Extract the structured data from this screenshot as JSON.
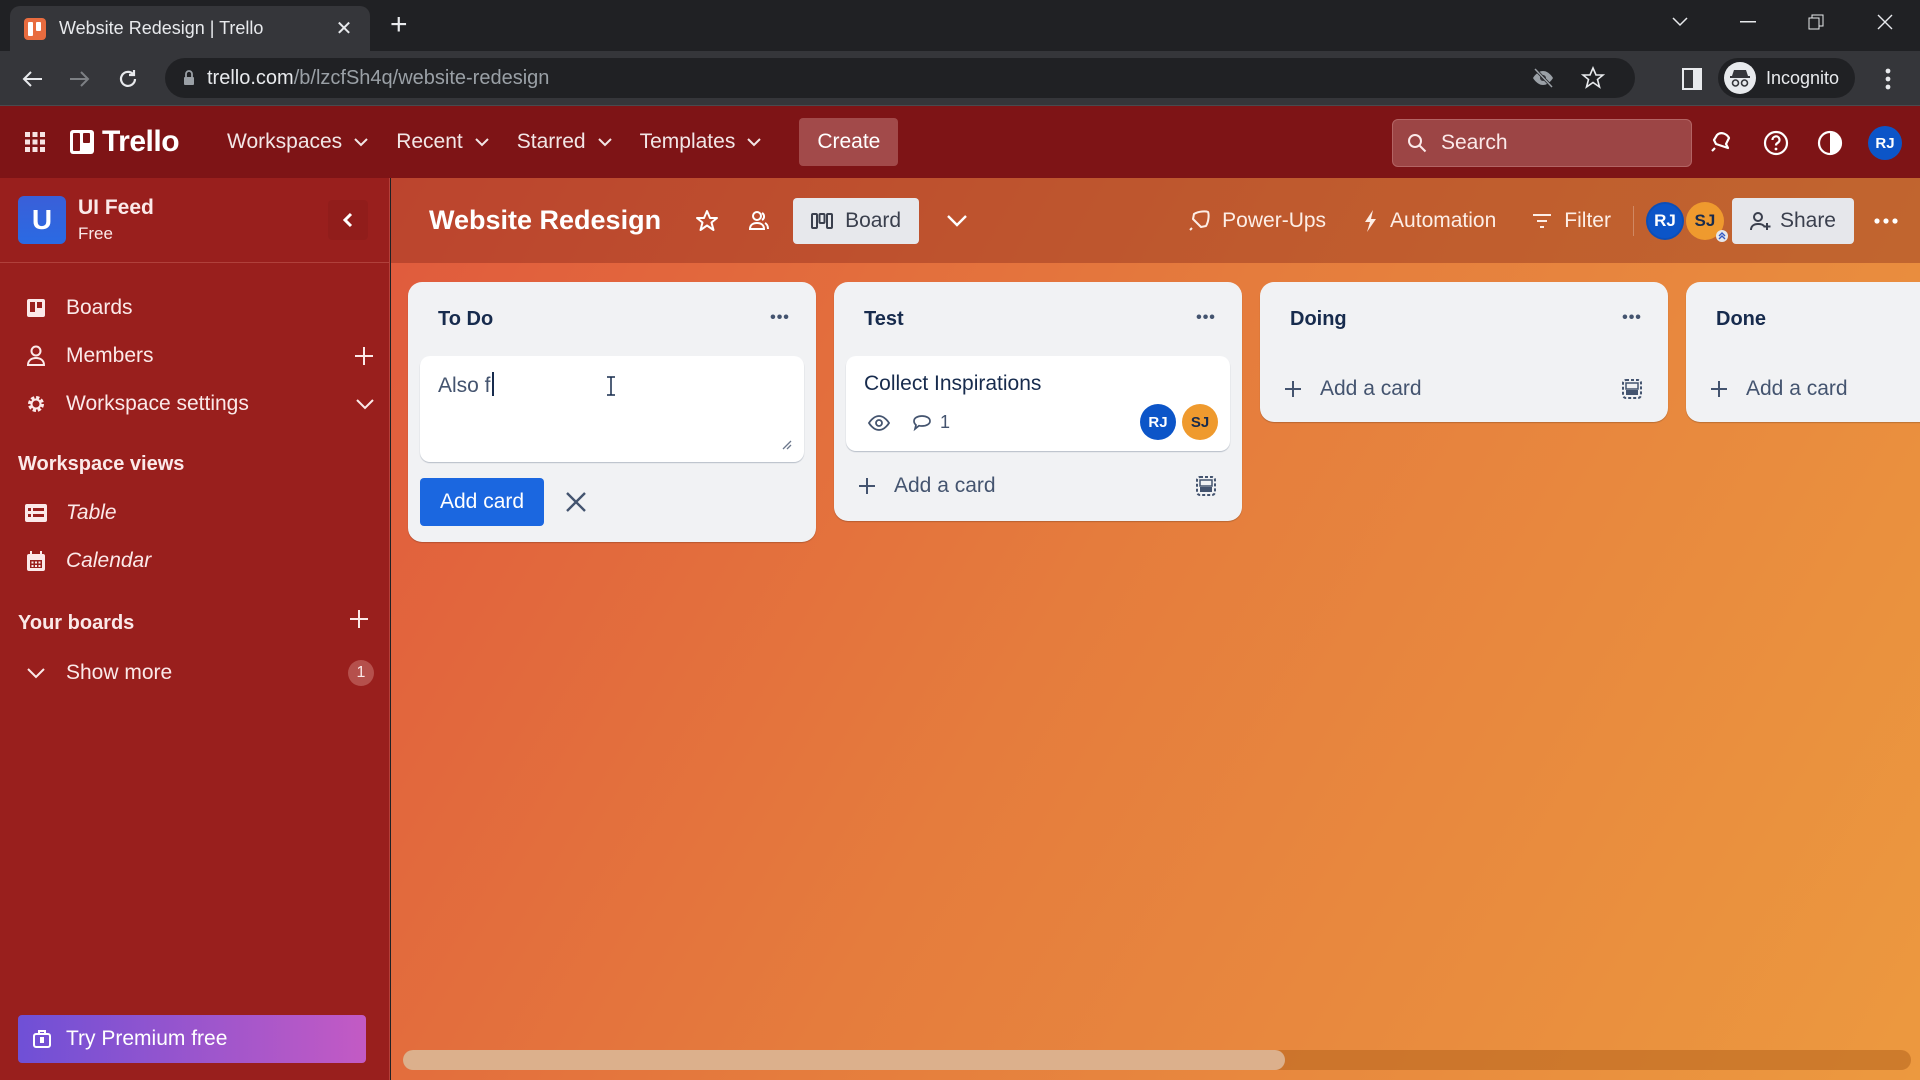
{
  "browser": {
    "tab_title": "Website Redesign | Trello",
    "url_host": "trello.com",
    "url_path": "/b/lzcfSh4q/website-redesign",
    "profile_label": "Incognito"
  },
  "header": {
    "logo_text": "Trello",
    "menus": [
      {
        "label": "Workspaces"
      },
      {
        "label": "Recent"
      },
      {
        "label": "Starred"
      },
      {
        "label": "Templates"
      }
    ],
    "create_label": "Create",
    "search_placeholder": "Search",
    "user_initials": "RJ"
  },
  "sidebar": {
    "workspace_initial": "U",
    "workspace_name": "UI Feed",
    "workspace_plan": "Free",
    "items": [
      {
        "label": "Boards",
        "icon": "board-icon"
      },
      {
        "label": "Members",
        "icon": "person-icon"
      },
      {
        "label": "Workspace settings",
        "icon": "gear-icon"
      }
    ],
    "views_heading": "Workspace views",
    "views": [
      {
        "label": "Table",
        "icon": "table-icon"
      },
      {
        "label": "Calendar",
        "icon": "calendar-icon"
      }
    ],
    "boards_heading": "Your boards",
    "show_more_label": "Show more",
    "show_more_count": "1",
    "premium_label": "Try Premium free"
  },
  "board": {
    "title": "Website Redesign",
    "view_label": "Board",
    "powerups_label": "Power-Ups",
    "automation_label": "Automation",
    "filter_label": "Filter",
    "members": [
      {
        "initials": "RJ",
        "color": "#0c55c8"
      },
      {
        "initials": "SJ",
        "color": "#ef9a2e"
      }
    ],
    "share_label": "Share",
    "scroll_position_fraction": 0.585,
    "lists": [
      {
        "title": "To Do",
        "composer": {
          "value": "Also f"
        },
        "add_button_label": "Add card"
      },
      {
        "title": "Test",
        "cards": [
          {
            "title": "Collect Inspirations",
            "comments": "1",
            "members": [
              "RJ",
              "SJ"
            ]
          }
        ],
        "add_label": "Add a card"
      },
      {
        "title": "Doing",
        "add_label": "Add a card"
      },
      {
        "title": "Done",
        "add_label": "Add a card"
      }
    ]
  }
}
